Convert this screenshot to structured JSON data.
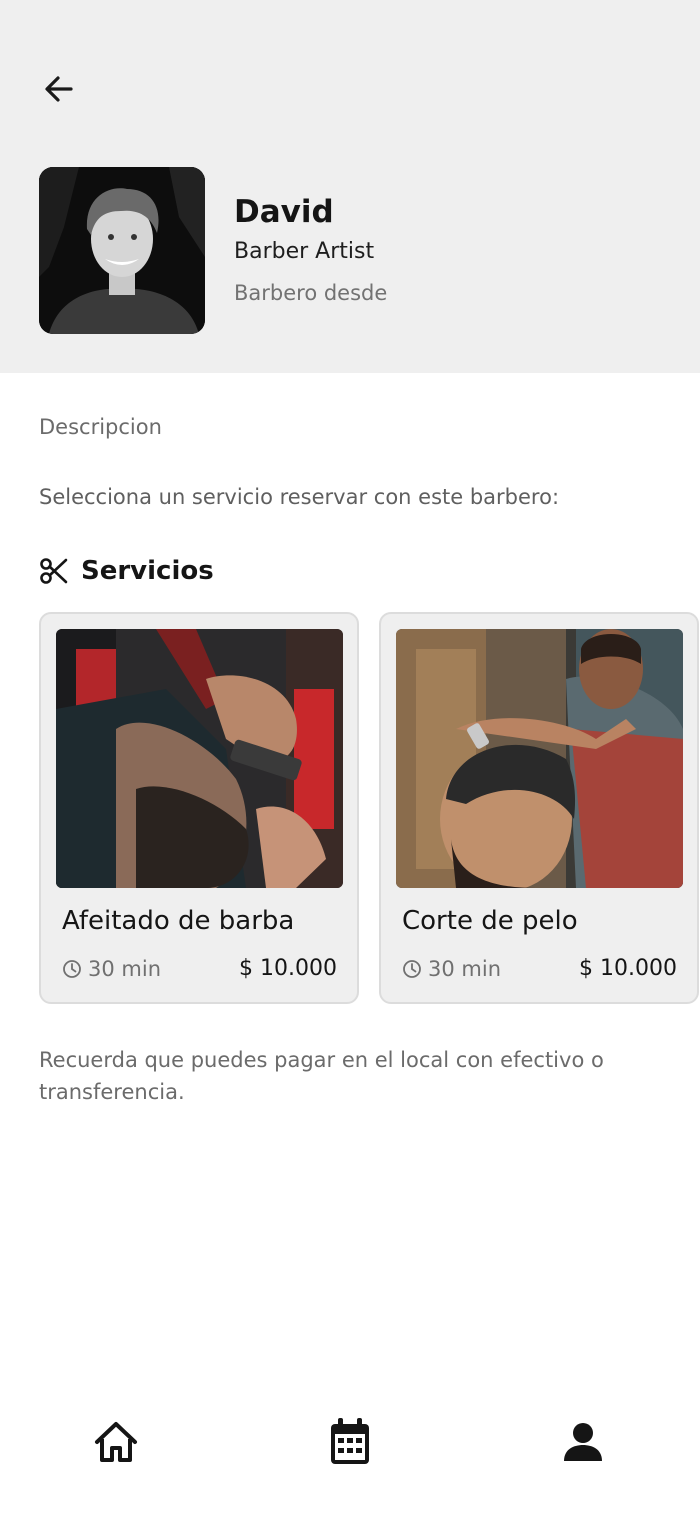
{
  "header": {
    "back_icon": "arrow-left-icon",
    "barber": {
      "name": "David",
      "role": "Barber Artist",
      "since_label": "Barbero desde"
    }
  },
  "content": {
    "description_label": "Descripcion",
    "select_prompt": "Selecciona un servicio reservar con este barbero:",
    "services_title": "Servicios",
    "services_icon": "scissors-icon",
    "services": [
      {
        "name": "Afeitado de barba",
        "duration": "30 min",
        "price": "$ 10.000"
      },
      {
        "name": "Corte de pelo",
        "duration": "30 min",
        "price": "$ 10.000"
      }
    ],
    "payment_note": "Recuerda que puedes pagar en el local con efectivo o transferencia."
  },
  "bottom_nav": {
    "items": [
      {
        "icon": "home-icon"
      },
      {
        "icon": "calendar-icon"
      },
      {
        "icon": "user-icon"
      }
    ]
  },
  "colors": {
    "header_bg": "#efefef",
    "card_bg": "#efefef",
    "muted_text": "#6b6b6b",
    "dark_text": "#151515"
  }
}
